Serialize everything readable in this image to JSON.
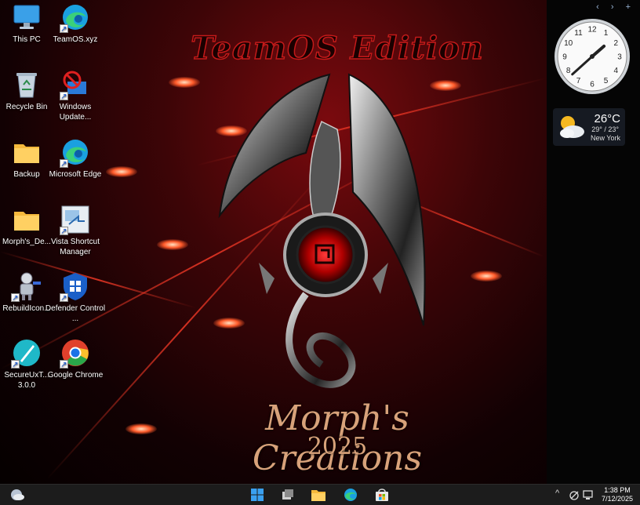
{
  "wallpaper": {
    "title": "TeamOS Edition",
    "signature": "Morph's Creations",
    "year": "2025"
  },
  "desktop_icons": [
    {
      "label": "This PC",
      "icon": "this-pc-icon",
      "shortcut": false
    },
    {
      "label": "TeamOS.xyz",
      "icon": "edge-icon",
      "shortcut": true
    },
    {
      "label": "Recycle Bin",
      "icon": "recycle-bin-icon",
      "shortcut": false
    },
    {
      "label": "Windows Update...",
      "icon": "windows-update-icon",
      "shortcut": true
    },
    {
      "label": "Backup",
      "icon": "folder-icon",
      "shortcut": false
    },
    {
      "label": "Microsoft Edge",
      "icon": "edge-icon",
      "shortcut": true
    },
    {
      "label": "Morph's_De...",
      "icon": "folder-icon",
      "shortcut": false
    },
    {
      "label": "Vista Shortcut Manager",
      "icon": "vista-shortcut-icon",
      "shortcut": true
    },
    {
      "label": "RebuildIcon...",
      "icon": "robot-icon",
      "shortcut": true
    },
    {
      "label": "Defender Control ...",
      "icon": "defender-shield-icon",
      "shortcut": true
    },
    {
      "label": "SecureUxT... 3.0.0",
      "icon": "secureux-icon",
      "shortcut": true
    },
    {
      "label": "Google Chrome",
      "icon": "chrome-icon",
      "shortcut": true
    }
  ],
  "sidebar": {
    "controls": "‹ › +",
    "clock": {
      "numbers": [
        "12",
        "1",
        "2",
        "3",
        "4",
        "5",
        "6",
        "7",
        "8",
        "9",
        "10",
        "11"
      ],
      "hour": 1,
      "minute": 38
    },
    "weather": {
      "temp": "26°C",
      "range": "29° / 23°",
      "city": "New York",
      "icon": "partly-cloudy-icon"
    }
  },
  "taskbar": {
    "apps": [
      "start-icon",
      "task-view-icon",
      "file-explorer-icon",
      "edge-icon",
      "store-icon"
    ],
    "tray_chevron": "^",
    "time": "1:38 PM",
    "date": "7/12/2025"
  },
  "colors": {
    "accent_red": "#c41a1a",
    "signature_gold": "#d8a27a",
    "taskbar_bg": "#1c1c1c"
  }
}
